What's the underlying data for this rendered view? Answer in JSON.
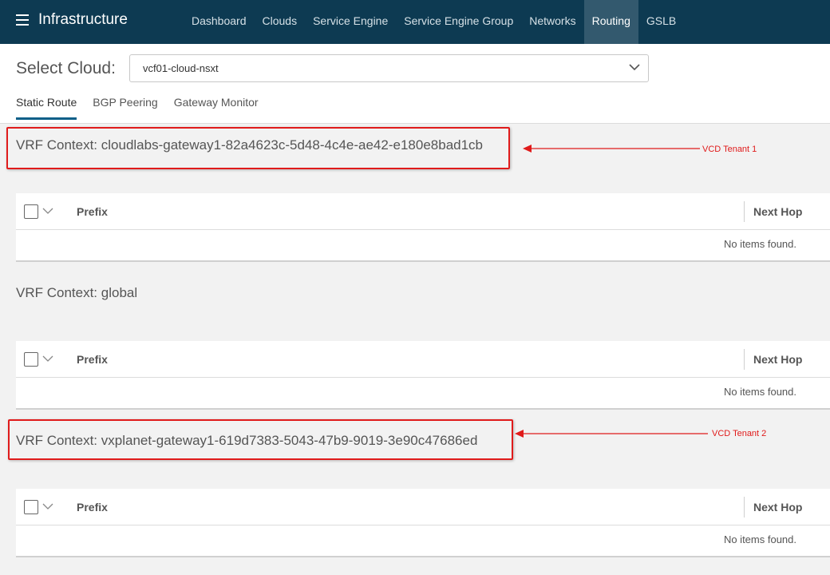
{
  "header": {
    "title": "Infrastructure",
    "nav": [
      {
        "label": "Dashboard"
      },
      {
        "label": "Clouds"
      },
      {
        "label": "Service Engine"
      },
      {
        "label": "Service Engine Group"
      },
      {
        "label": "Networks"
      },
      {
        "label": "Routing",
        "active": true
      },
      {
        "label": "GSLB"
      }
    ]
  },
  "cloud_select": {
    "label": "Select Cloud:",
    "value": "vcf01-cloud-nsxt"
  },
  "tabs": [
    {
      "label": "Static Route",
      "active": true
    },
    {
      "label": "BGP Peering"
    },
    {
      "label": "Gateway Monitor"
    }
  ],
  "vrf_sections": [
    {
      "title": "VRF Context: cloudlabs-gateway1-82a4623c-5d48-4c4e-ae42-e180e8bad1cb",
      "columns": {
        "prefix": "Prefix",
        "next_hop": "Next Hop"
      },
      "empty_text": "No items found."
    },
    {
      "title": "VRF Context: global",
      "columns": {
        "prefix": "Prefix",
        "next_hop": "Next Hop"
      },
      "empty_text": "No items found."
    },
    {
      "title": "VRF Context: vxplanet-gateway1-619d7383-5043-47b9-9019-3e90c47686ed",
      "columns": {
        "prefix": "Prefix",
        "next_hop": "Next Hop"
      },
      "empty_text": "No items found."
    }
  ],
  "annotations": [
    {
      "label": "VCD Tenant 1"
    },
    {
      "label": "VCD Tenant 2"
    }
  ],
  "colors": {
    "header_bg": "#0d3a52",
    "nav_active_bg": "#33596e",
    "tab_underline": "#0d5f88",
    "annotation": "#e01b1b",
    "content_bg": "#f2f2f2"
  }
}
